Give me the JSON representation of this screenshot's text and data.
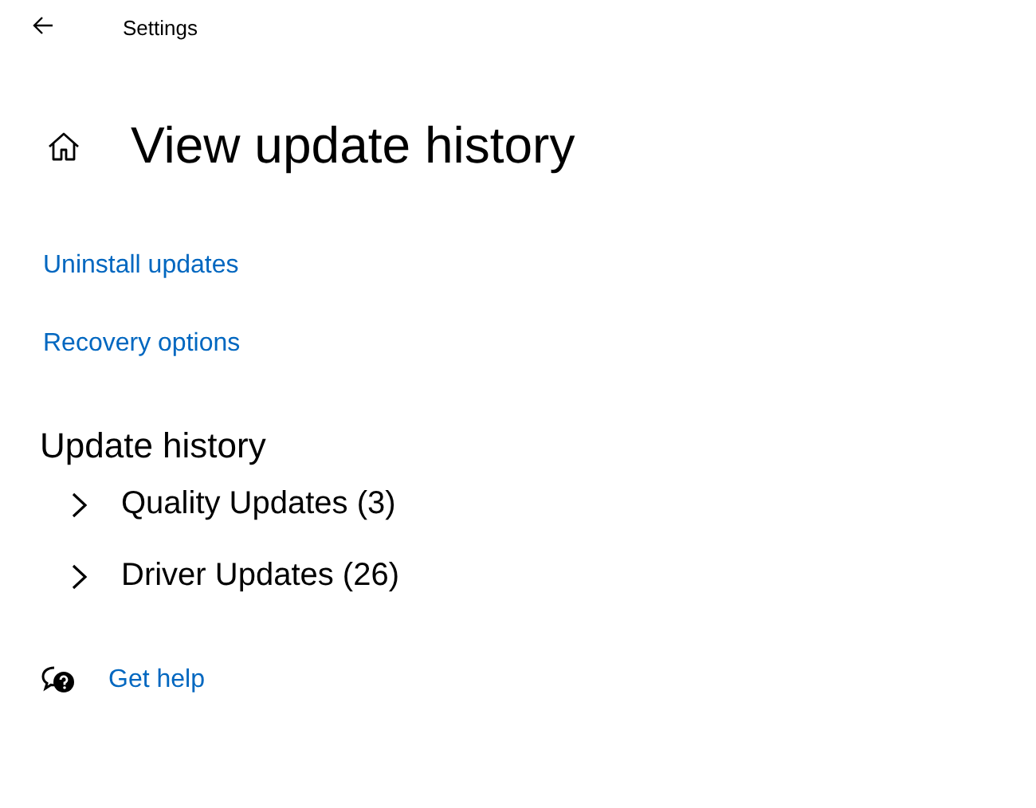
{
  "window": {
    "title": "Settings"
  },
  "page": {
    "title": "View update history"
  },
  "links": [
    "Uninstall updates",
    "Recovery options"
  ],
  "history": {
    "heading": "Update history",
    "groups": [
      {
        "label": "Quality Updates (3)",
        "expanded": false
      },
      {
        "label": "Driver Updates (26)",
        "expanded": false
      }
    ]
  },
  "help": {
    "label": "Get help"
  }
}
